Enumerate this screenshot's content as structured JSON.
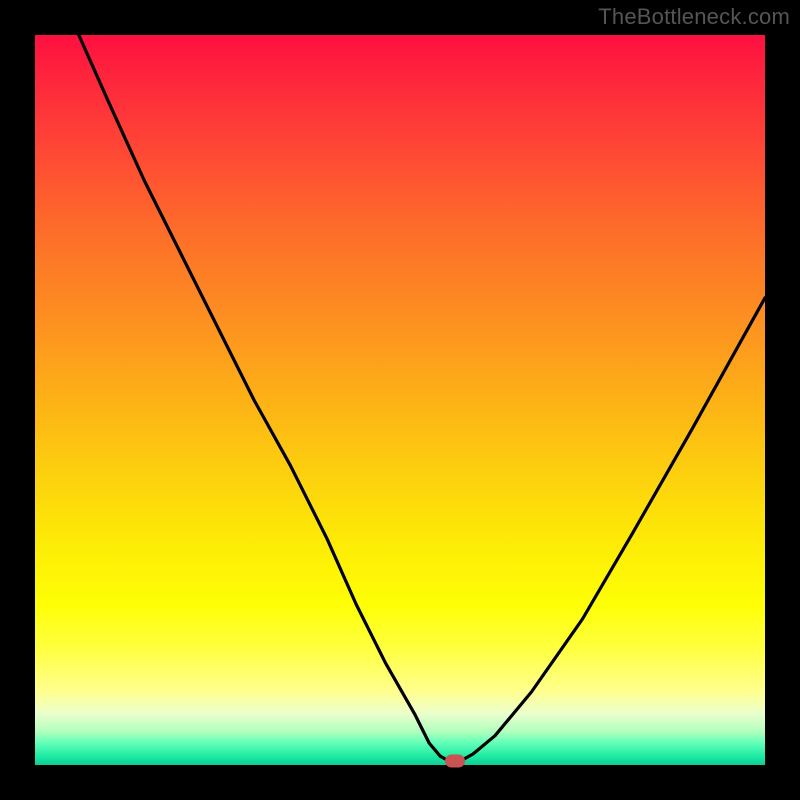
{
  "attribution": "TheBottleneck.com",
  "chart_data": {
    "type": "line",
    "title": "",
    "xlabel": "",
    "ylabel": "",
    "xlim": [
      0,
      100
    ],
    "ylim": [
      0,
      100
    ],
    "grid": false,
    "series": [
      {
        "name": "bottleneck-curve",
        "x": [
          6,
          10,
          15,
          20,
          25,
          30,
          35,
          40,
          44,
          48,
          52,
          54,
          55.5,
          57,
          58,
          60,
          63,
          68,
          75,
          82,
          90,
          100
        ],
        "y": [
          100,
          91,
          80,
          70,
          60,
          50,
          41,
          31,
          22,
          14,
          7,
          3,
          1.2,
          0.4,
          0.4,
          1.5,
          4,
          10,
          20,
          32,
          46,
          64
        ]
      }
    ],
    "marker": {
      "x": 57.5,
      "y": 0.6
    },
    "colors": {
      "curve": "#000000",
      "marker": "#c95353",
      "bg_top": "#fe1040",
      "bg_bottom": "#0ecc94",
      "frame": "#000000"
    }
  }
}
